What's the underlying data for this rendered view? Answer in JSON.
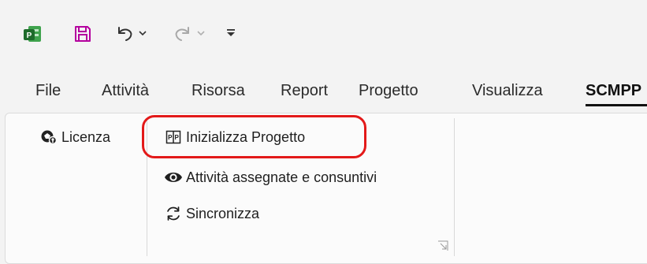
{
  "quick_access": {
    "app_icon": "project-app-icon",
    "save_icon": "save-icon",
    "undo_icon": "undo-icon",
    "redo_icon": "redo-icon",
    "customize_icon": "customize-qat-icon"
  },
  "tabs": [
    {
      "label": "File"
    },
    {
      "label": "Attività"
    },
    {
      "label": "Risorsa"
    },
    {
      "label": "Report"
    },
    {
      "label": "Progetto"
    },
    {
      "label": "Visualizza"
    },
    {
      "label": "SCMPP",
      "active": true
    }
  ],
  "ribbon": {
    "license_label": "Licenza",
    "init_project_label": "Inizializza Progetto",
    "tasks_label": "Attività assegnate e consuntivi",
    "sync_label": "Sincronizza"
  },
  "colors": {
    "highlight": "#e31919",
    "app_icon": "#2e7d32",
    "save_icon": "#b4009e"
  }
}
